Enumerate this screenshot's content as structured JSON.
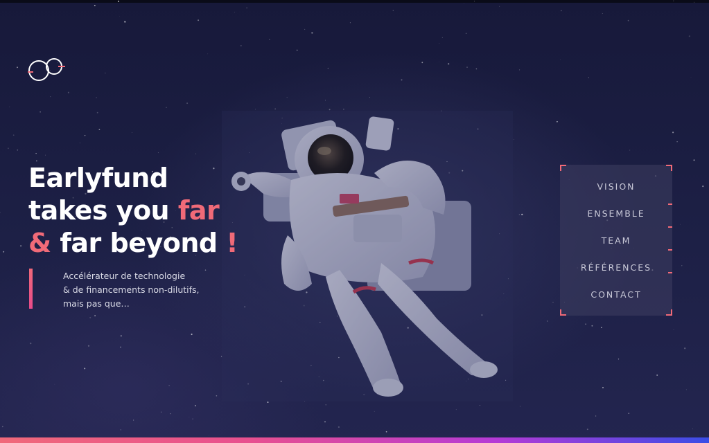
{
  "colors": {
    "accent": "#f06a78",
    "background": "#1d2046",
    "gradient_start": "#f0697a",
    "gradient_end": "#3a4de6"
  },
  "logo": {
    "icon": "infinity-logo-icon"
  },
  "hero": {
    "line1": "Earlyfund",
    "line2_start": "takes you ",
    "line2_accent": "far",
    "line3_accent": "&",
    "line3_main": " far beyond ",
    "line3_end": "!"
  },
  "tagline": {
    "line1": "Accélérateur de technologie",
    "line2": "& de financements non-dilutifs,",
    "line3": "mais pas que…"
  },
  "nav": {
    "items": [
      {
        "label": "VISION"
      },
      {
        "label": "ENSEMBLE"
      },
      {
        "label": "TEAM"
      },
      {
        "label": "RÉFÉRENCES"
      },
      {
        "label": "CONTACT"
      }
    ]
  },
  "background_image": "astronaut-in-space"
}
